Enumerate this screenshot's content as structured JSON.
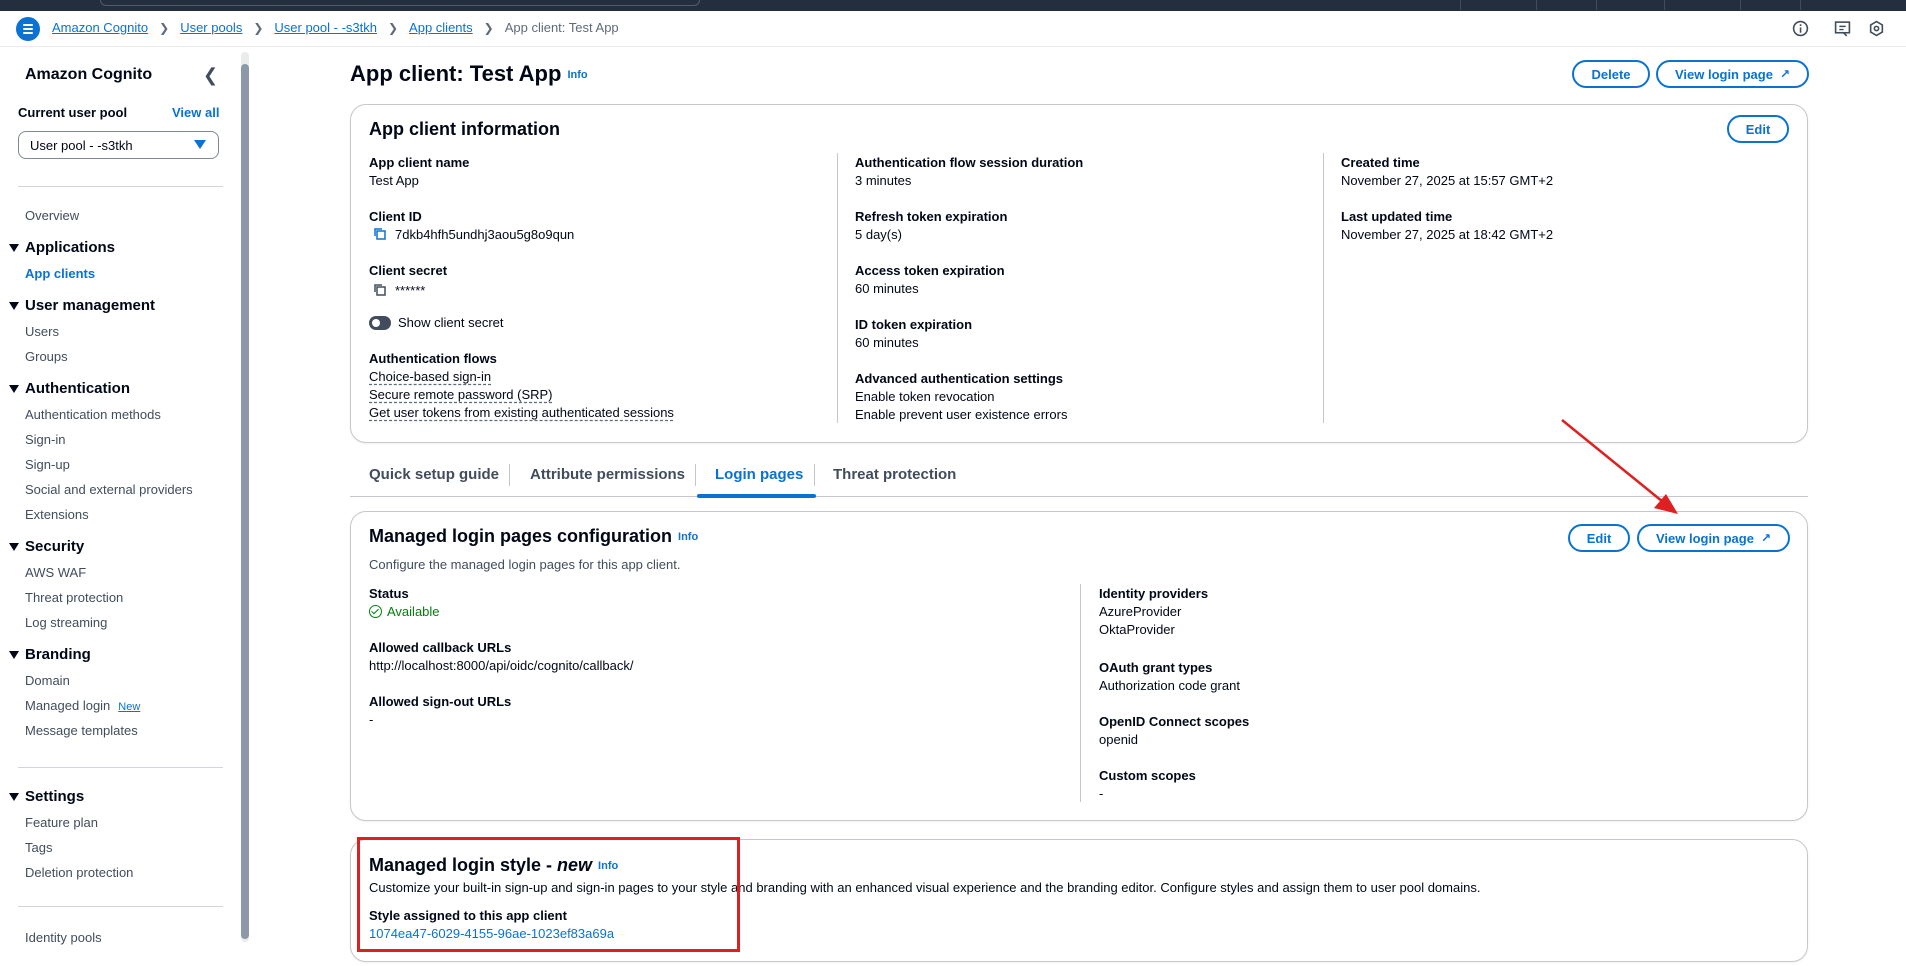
{
  "breadcrumbs": [
    "Amazon Cognito",
    "User pools",
    "User pool - -s3tkh",
    "App clients",
    "App client: Test App"
  ],
  "sidebar": {
    "title": "Amazon Cognito",
    "current_label": "Current user pool",
    "view_all": "View all",
    "selected_pool": "User pool - -s3tkh",
    "overview": "Overview",
    "sections": [
      {
        "title": "Applications",
        "items": [
          "App clients"
        ]
      },
      {
        "title": "User management",
        "items": [
          "Users",
          "Groups"
        ]
      },
      {
        "title": "Authentication",
        "items": [
          "Authentication methods",
          "Sign-in",
          "Sign-up",
          "Social and external providers",
          "Extensions"
        ]
      },
      {
        "title": "Security",
        "items": [
          "AWS WAF",
          "Threat protection",
          "Log streaming"
        ]
      },
      {
        "title": "Branding",
        "items": [
          "Domain",
          "Managed login",
          "Message templates"
        ]
      },
      {
        "title": "Settings",
        "items": [
          "Feature plan",
          "Tags",
          "Deletion protection"
        ]
      }
    ],
    "new_badge": "New",
    "identity_pools": "Identity pools"
  },
  "header": {
    "title": "App client: Test App",
    "info": "Info",
    "delete_label": "Delete",
    "view_login_label": "View login page"
  },
  "app_client_info": {
    "heading": "App client information",
    "edit_label": "Edit",
    "name_label": "App client name",
    "name_value": "Test App",
    "client_id_label": "Client ID",
    "client_id_value": "7dkb4hfh5undhj3aou5g8o9qun",
    "secret_label": "Client secret",
    "secret_value": "******",
    "show_secret_label": "Show client secret",
    "auth_flows_label": "Authentication flows",
    "auth_flows": [
      "Choice-based sign-in",
      "Secure remote password (SRP)",
      "Get user tokens from existing authenticated sessions"
    ],
    "session_label": "Authentication flow session duration",
    "session_value": "3 minutes",
    "refresh_label": "Refresh token expiration",
    "refresh_value": "5 day(s)",
    "access_label": "Access token expiration",
    "access_value": "60 minutes",
    "id_label": "ID token expiration",
    "id_value": "60 minutes",
    "advanced_label": "Advanced authentication settings",
    "advanced_values": [
      "Enable token revocation",
      "Enable prevent user existence errors"
    ],
    "created_label": "Created time",
    "created_value": "November 27, 2025 at 15:57 GMT+2",
    "updated_label": "Last updated time",
    "updated_value": "November 27, 2025 at 18:42 GMT+2"
  },
  "tabs": [
    "Quick setup guide",
    "Attribute permissions",
    "Login pages",
    "Threat protection"
  ],
  "active_tab": "Login pages",
  "managed_login": {
    "heading": "Managed login pages configuration",
    "info": "Info",
    "subtitle": "Configure the managed login pages for this app client.",
    "edit_label": "Edit",
    "view_login_label": "View login page",
    "status_label": "Status",
    "status_value": "Available",
    "callback_label": "Allowed callback URLs",
    "callback_value": "http://localhost:8000/api/oidc/cognito/callback/",
    "signout_label": "Allowed sign-out URLs",
    "signout_value": "-",
    "idp_label": "Identity providers",
    "idp_values": [
      "AzureProvider",
      "OktaProvider"
    ],
    "grant_label": "OAuth grant types",
    "grant_value": "Authorization code grant",
    "scopes_label": "OpenID Connect scopes",
    "scopes_value": "openid",
    "custom_label": "Custom scopes",
    "custom_value": "-"
  },
  "login_style": {
    "heading": "Managed login style - ",
    "heading_new": "new",
    "info": "Info",
    "subtitle": "Customize your built-in sign-up and sign-in pages to your style and branding with an enhanced visual experience and the branding editor. Configure styles and assign them to user pool domains.",
    "assigned_label": "Style assigned to this app client",
    "assigned_value": "1074ea47-6029-4155-96ae-1023ef83a69a"
  },
  "colors": {
    "accent": "#0972d3",
    "success": "#037f0c",
    "annotation": "#e02020",
    "nav_dark": "#232f3e"
  }
}
